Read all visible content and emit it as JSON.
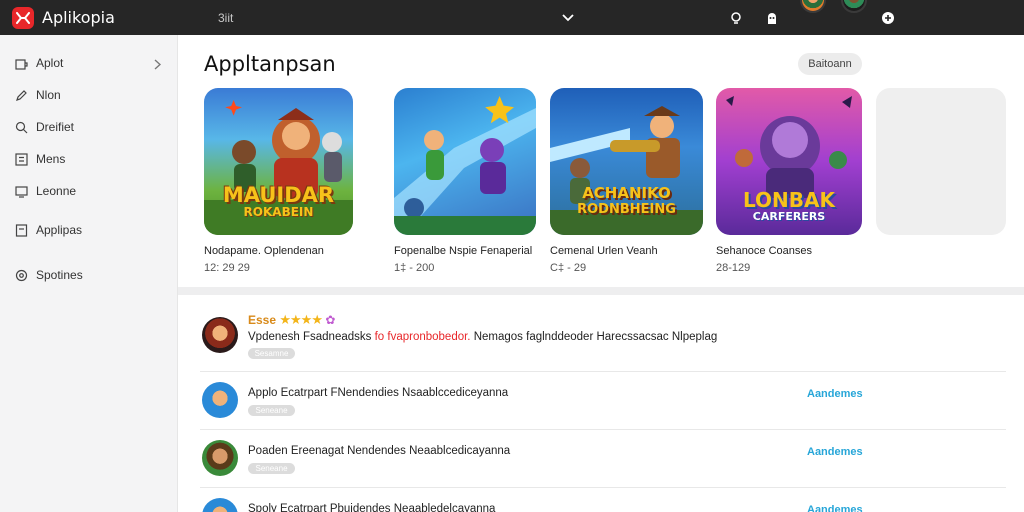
{
  "app": {
    "name": "Aplikopia",
    "search_text": "3iit"
  },
  "sidebar": {
    "items": [
      {
        "label": "Aplot",
        "icon": "puzzle-icon"
      },
      {
        "label": "Nlon",
        "icon": "pen-icon"
      },
      {
        "label": "Dreifiet",
        "icon": "search-icon"
      },
      {
        "label": "Mens",
        "icon": "list-icon"
      },
      {
        "label": "Leonne",
        "icon": "monitor-icon"
      },
      {
        "label": "Applipas",
        "icon": "document-icon"
      },
      {
        "label": "Spotines",
        "icon": "gear-icon"
      }
    ]
  },
  "featured": {
    "title": "Appltanpsan",
    "see_all": "Baitoann",
    "cards": [
      {
        "title": "Nodapame. Oplendenan",
        "sub": "12: 29 29",
        "banner": "MAUIDAR",
        "banner_sub": "ROKABEIN"
      },
      {
        "title": "Fopenalbe Nspie Fenaperial",
        "sub": "1‡ - 200",
        "banner": "",
        "banner_sub": ""
      },
      {
        "title": "Cemenal Urlen Veanh",
        "sub": "C‡ - 29",
        "banner": "ACHANIKO",
        "banner_sub": "RODNBHEING"
      },
      {
        "title": "Sehanoce Coanses",
        "sub": "28-129",
        "banner": "LONBAK",
        "banner_sub": "CARFERERS"
      }
    ]
  },
  "reviews": [
    {
      "name": "Esse",
      "stars": "★★★★",
      "text_prefix": "Vpdenesh Fsadneadsks",
      "text_highlight": "fo fvapronbobedor.",
      "text_suffix": "Nemagos faglnddeoder Harecssacsac Nlpeplag",
      "pill": "Sesamne",
      "action": ""
    },
    {
      "name": "",
      "stars": "",
      "text_prefix": "Applo Ecatrpart FNendendies Nsaablccediceyanna",
      "text_highlight": "",
      "text_suffix": "",
      "pill": "Seneane",
      "action": "Aandemes"
    },
    {
      "name": "",
      "stars": "",
      "text_prefix": "Poaden Ereenagat Nendendes Neaablcedicayanna",
      "text_highlight": "",
      "text_suffix": "",
      "pill": "Seneane",
      "action": "Aandemes"
    },
    {
      "name": "",
      "stars": "",
      "text_prefix": "Spoly Ecatrpart Pbuidendes Neaabledelcayanna",
      "text_highlight": "",
      "text_suffix": "",
      "pill": "",
      "action": "Aandemes"
    }
  ],
  "colors": {
    "brand": "#e8272a",
    "topbar": "#262626",
    "accent": "#27a6d8",
    "star": "#f3b51a"
  }
}
